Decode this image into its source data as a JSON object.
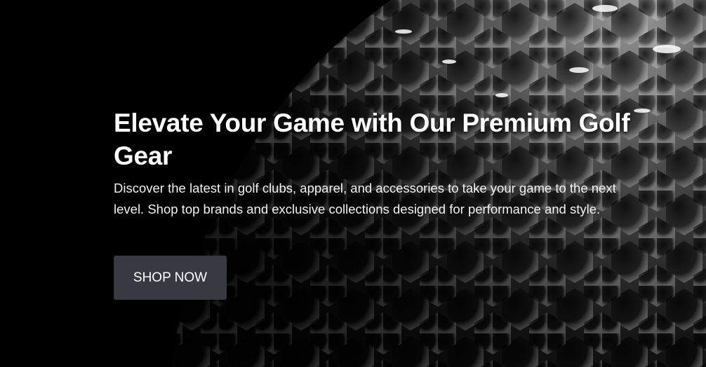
{
  "hero": {
    "title": "Elevate Your Game with Our Premium Golf Gear",
    "description": "Discover the latest in golf clubs, apparel, and accessories to take your game to the next level. Shop top brands and exclusive collections designed for performance and style.",
    "cta_label": "SHOP NOW"
  },
  "colors": {
    "background": "#000000",
    "button": "#373a40",
    "text": "#ffffff"
  }
}
